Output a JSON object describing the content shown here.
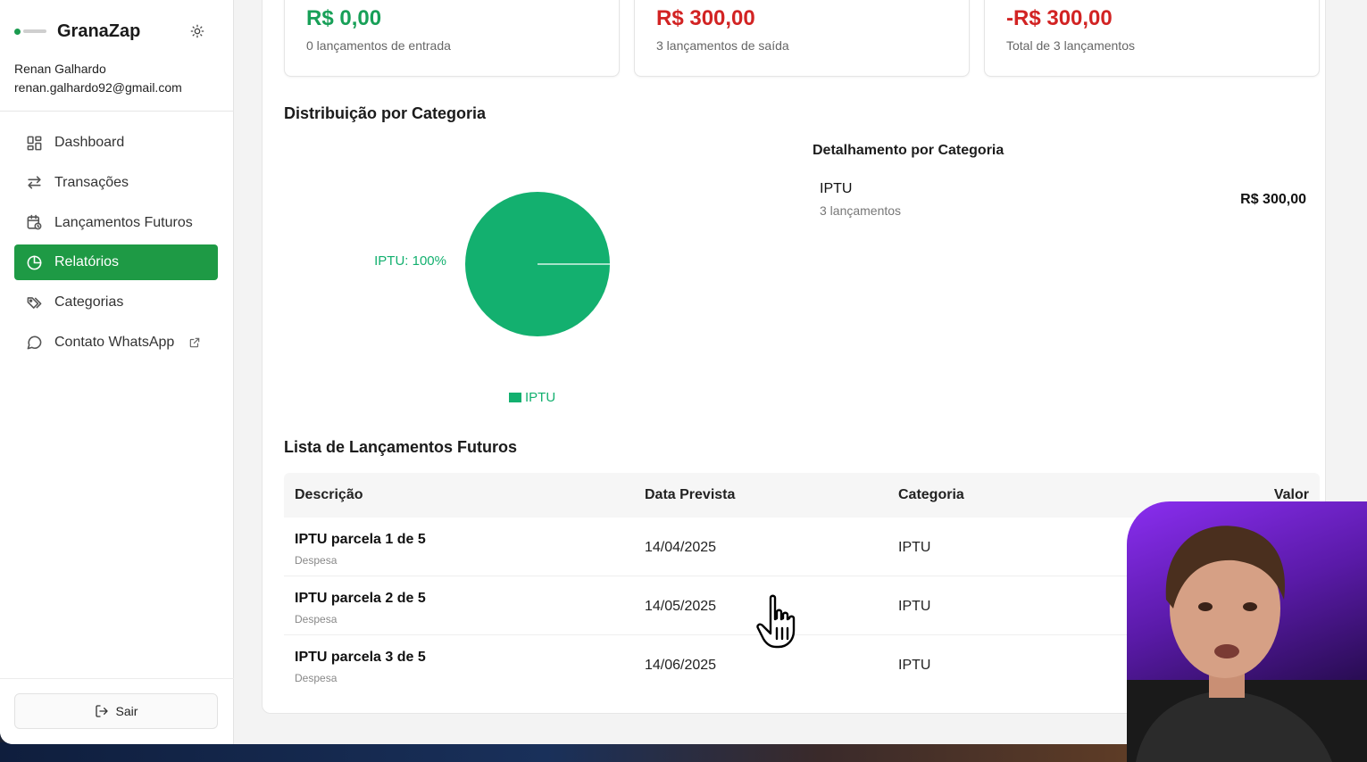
{
  "app": {
    "name": "GranaZap",
    "user_name": "Renan Galhardo",
    "user_email": "renan.galhardo92@gmail.com"
  },
  "sidebar": {
    "items": [
      {
        "label": "Dashboard",
        "icon": "grid-icon",
        "active": false
      },
      {
        "label": "Transações",
        "icon": "arrows-swap-icon",
        "active": false
      },
      {
        "label": "Lançamentos Futuros",
        "icon": "calendar-clock-icon",
        "active": false
      },
      {
        "label": "Relatórios",
        "icon": "pie-chart-icon",
        "active": true
      },
      {
        "label": "Categorias",
        "icon": "tags-icon",
        "active": false
      },
      {
        "label": "Contato WhatsApp",
        "icon": "message-circle-icon",
        "active": false,
        "external": true
      }
    ],
    "logout_label": "Sair"
  },
  "stats": [
    {
      "value": "R$ 0,00",
      "sub": "0 lançamentos de entrada",
      "color": "#18a058"
    },
    {
      "value": "R$ 300,00",
      "sub": "3 lançamentos de saída",
      "color": "#d22323"
    },
    {
      "value": "-R$ 300,00",
      "sub": "Total de 3 lançamentos",
      "color": "#d22323"
    }
  ],
  "distribution": {
    "title": "Distribuição por Categoria",
    "detail_title": "Detalhamento por Categoria",
    "detail": {
      "name": "IPTU",
      "count": "3 lançamentos",
      "amount": "R$ 300,00"
    }
  },
  "chart_data": {
    "type": "pie",
    "title": "",
    "slices": [
      {
        "label": "IPTU",
        "value": 100,
        "color": "#13b06f"
      }
    ],
    "data_labels": [
      "IPTU: 100%"
    ],
    "legend": [
      "IPTU"
    ],
    "legend_position": "bottom"
  },
  "future_list": {
    "title": "Lista de Lançamentos Futuros",
    "columns": [
      "Descrição",
      "Data Prevista",
      "Categoria",
      "Valor"
    ],
    "rows": [
      {
        "desc": "IPTU parcela 1 de 5",
        "type": "Despesa",
        "date": "14/04/2025",
        "category": "IPTU"
      },
      {
        "desc": "IPTU parcela 2 de 5",
        "type": "Despesa",
        "date": "14/05/2025",
        "category": "IPTU"
      },
      {
        "desc": "IPTU parcela 3 de 5",
        "type": "Despesa",
        "date": "14/06/2025",
        "category": "IPTU"
      }
    ]
  },
  "colors": {
    "accent": "#1e9a45",
    "income": "#18a058",
    "expense": "#d22323",
    "chart": "#13b06f"
  }
}
